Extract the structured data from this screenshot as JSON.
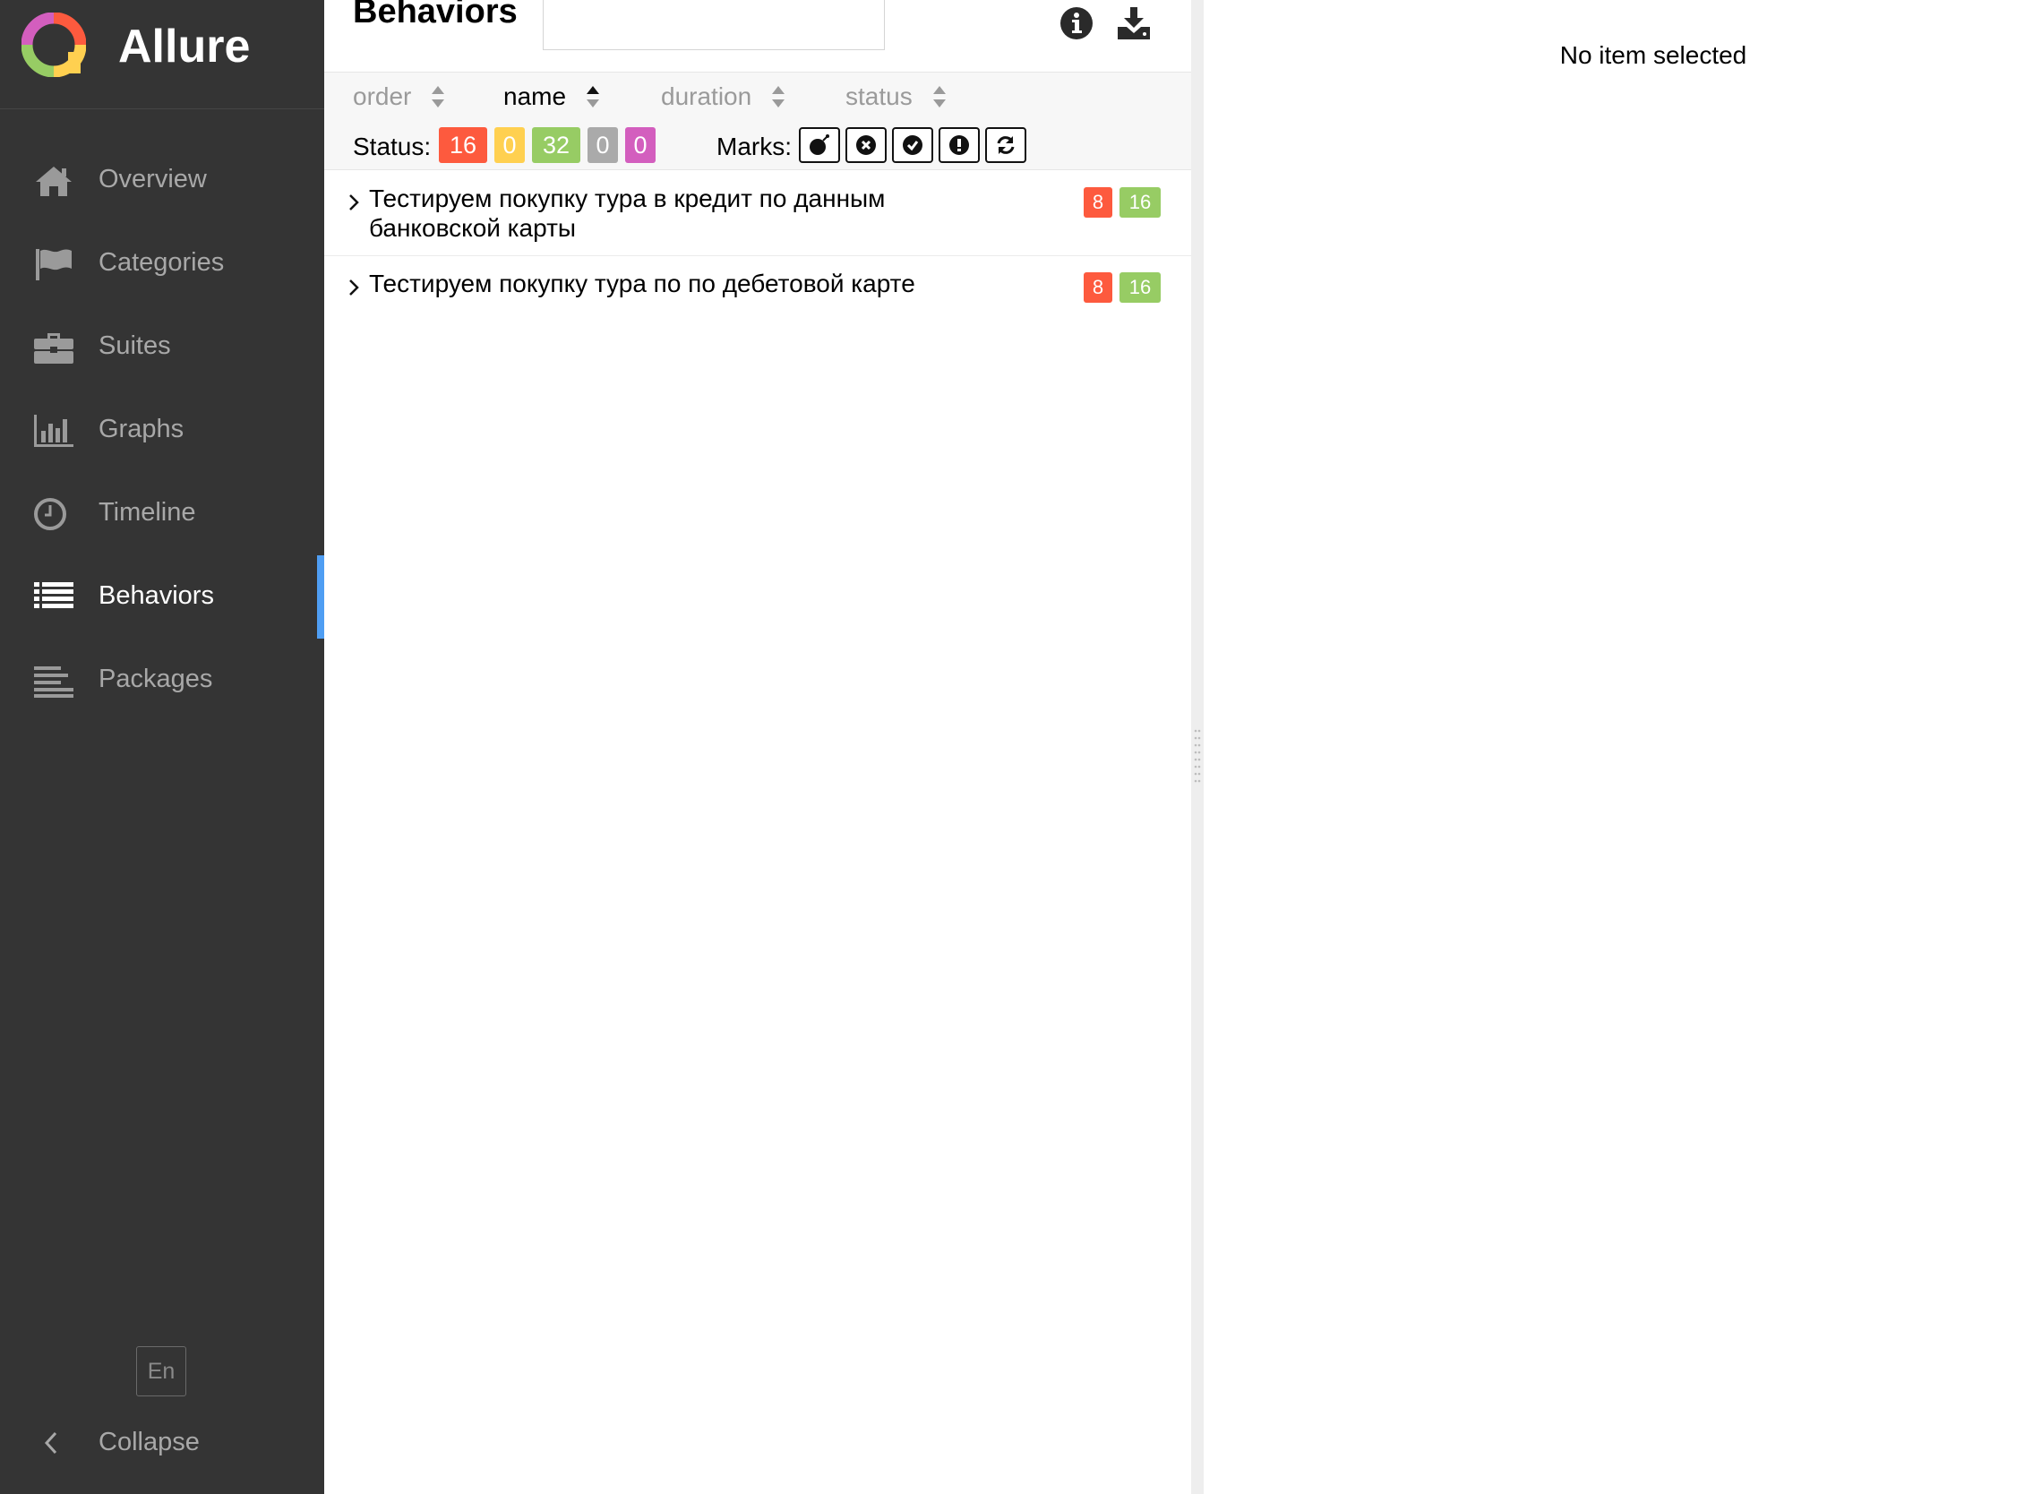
{
  "app": {
    "name": "Allure"
  },
  "colors": {
    "failed": "#fd5a3e",
    "broken": "#ffd050",
    "passed": "#97cc64",
    "skipped": "#aaaaaa",
    "unknown": "#d35ebe",
    "accent": "#4f9ef3",
    "sidebar_bg": "#343434"
  },
  "sidebar": {
    "items": [
      {
        "label": "Overview",
        "icon": "home-icon"
      },
      {
        "label": "Categories",
        "icon": "flag-icon"
      },
      {
        "label": "Suites",
        "icon": "briefcase-icon"
      },
      {
        "label": "Graphs",
        "icon": "bar-chart-icon"
      },
      {
        "label": "Timeline",
        "icon": "clock-icon"
      },
      {
        "label": "Behaviors",
        "icon": "list-icon",
        "active": true
      },
      {
        "label": "Packages",
        "icon": "align-left-icon"
      }
    ],
    "language": "En",
    "collapse_label": "Collapse"
  },
  "pane": {
    "title": "Behaviors",
    "search": {
      "value": "",
      "placeholder": ""
    },
    "sorters": [
      {
        "label": "order",
        "active": false
      },
      {
        "label": "name",
        "active": true,
        "direction": "desc"
      },
      {
        "label": "duration",
        "active": false
      },
      {
        "label": "status",
        "active": false
      }
    ],
    "status_label": "Status:",
    "status_counts": [
      {
        "status": "failed",
        "count": "16"
      },
      {
        "status": "broken",
        "count": "0"
      },
      {
        "status": "passed",
        "count": "32"
      },
      {
        "status": "skipped",
        "count": "0"
      },
      {
        "status": "unknown",
        "count": "0"
      }
    ],
    "marks_label": "Marks:",
    "marks": [
      "bomb-icon",
      "times-circle-icon",
      "check-circle-icon",
      "exclamation-circle-icon",
      "refresh-icon"
    ],
    "rows": [
      {
        "title": "Тестируем покупку тура в кредит по данным банковской карты",
        "failed": "8",
        "passed": "16"
      },
      {
        "title": "Тестируем покупку тура по по дебетовой карте",
        "failed": "8",
        "passed": "16"
      }
    ]
  },
  "detail": {
    "empty_text": "No item selected"
  }
}
